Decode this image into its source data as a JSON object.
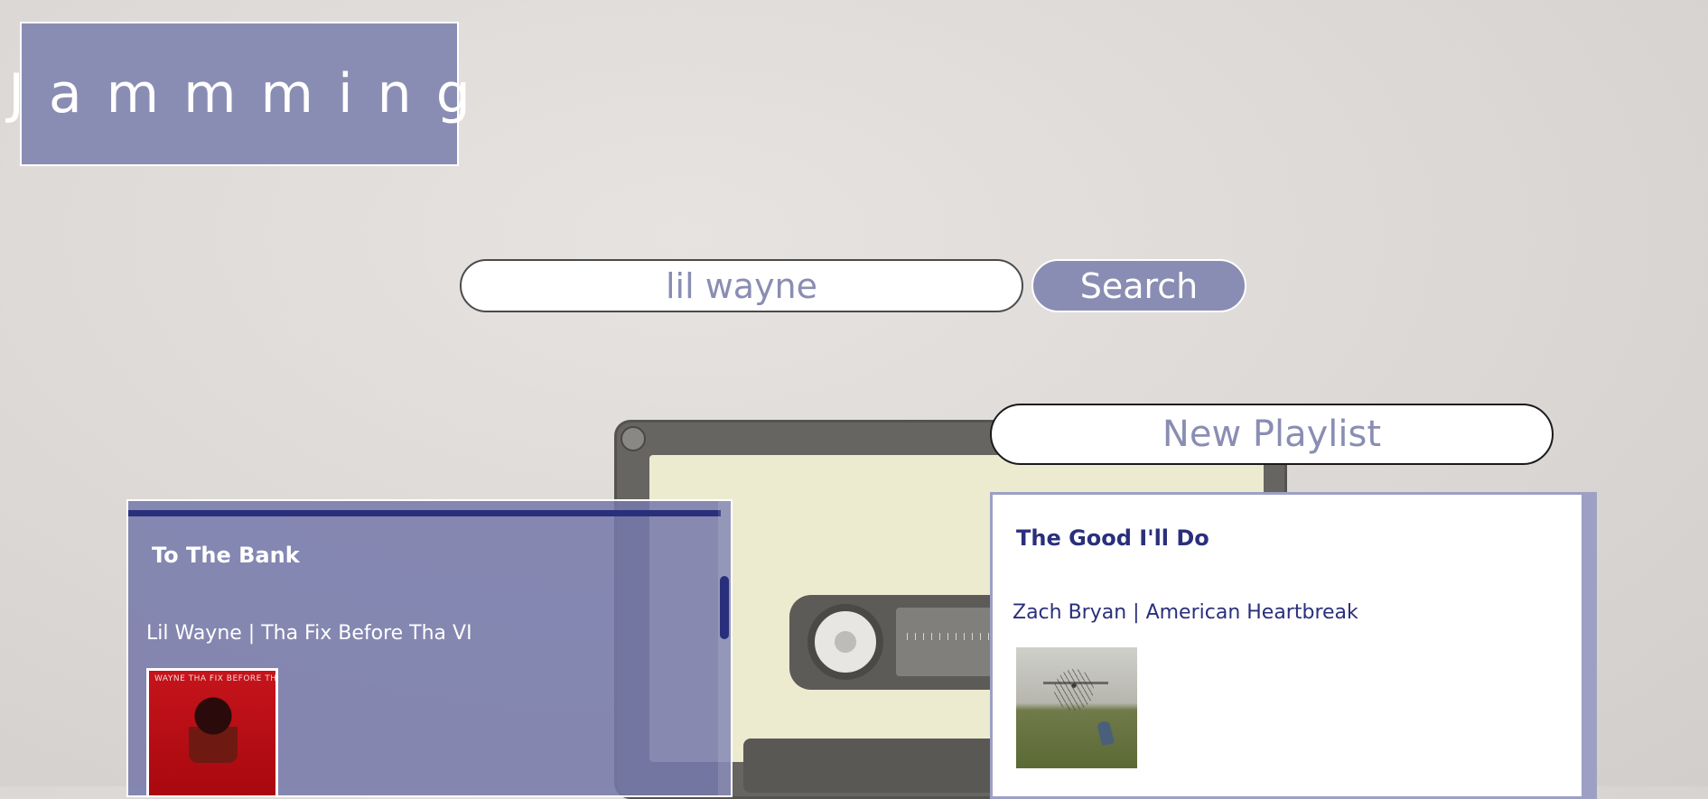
{
  "app": {
    "logo": "Jammming"
  },
  "search": {
    "value": "lil wayne",
    "button_label": "Search"
  },
  "search_results": {
    "tracks": [
      {
        "name": "To The Bank",
        "artist_album": "Lil Wayne | Tha Fix Before Tha VI",
        "cover_text": "WAYNE THA FIX BEFORE THA VI"
      }
    ]
  },
  "playlist": {
    "name": "New Playlist",
    "tracks": [
      {
        "name": "The Good I'll Do",
        "artist_album": "Zach Bryan | American Heartbreak"
      }
    ]
  },
  "colors": {
    "brand": "#8a8db3",
    "accent_dark": "#2a2f7c",
    "background": "#dcd8d6"
  },
  "icons": {
    "cassette": "cassette-tape-illustration"
  }
}
